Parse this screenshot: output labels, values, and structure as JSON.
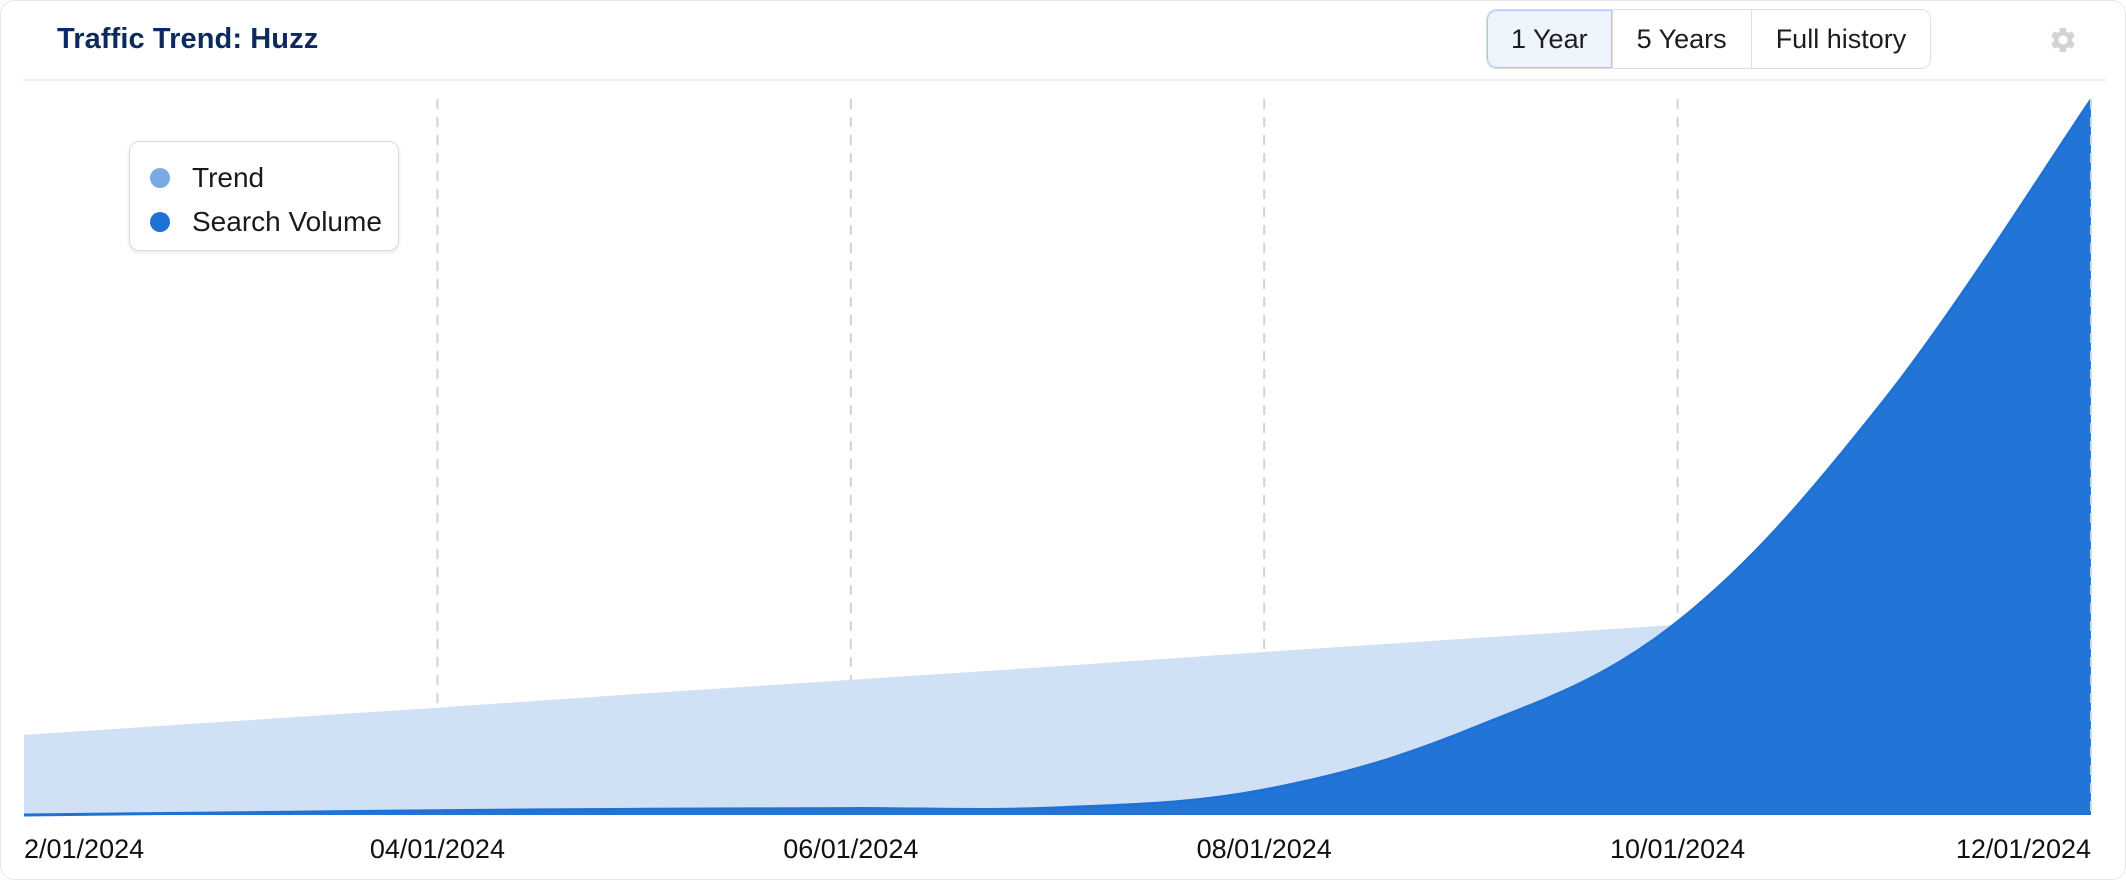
{
  "header": {
    "title": "Traffic Trend: Huzz",
    "range_buttons": [
      {
        "label": "1 Year",
        "active": true
      },
      {
        "label": "5 Years",
        "active": false
      },
      {
        "label": "Full history",
        "active": false
      }
    ],
    "settings_icon": "gear-icon"
  },
  "colors": {
    "title": "#0d2a5c",
    "trend": "#7aa9e6",
    "trend_fill": "#d0e0f5",
    "search_volume": "#1f71d6",
    "gridline": "#cfd3d8",
    "gear": "#d3d3d3"
  },
  "chart_data": {
    "type": "area",
    "title": "Traffic Trend: Huzz",
    "xlabel": "",
    "ylabel": "",
    "x": [
      "02/01/2024",
      "03/01/2024",
      "04/01/2024",
      "05/01/2024",
      "06/01/2024",
      "07/01/2024",
      "08/01/2024",
      "09/01/2024",
      "10/01/2024",
      "11/01/2024",
      "12/01/2024"
    ],
    "tick_labels": [
      "2/01/2024",
      "04/01/2024",
      "06/01/2024",
      "08/01/2024",
      "10/01/2024",
      "12/01/2024"
    ],
    "tick_indices": [
      0,
      2,
      4,
      6,
      8,
      10
    ],
    "series": [
      {
        "name": "Trend",
        "values": [
          11.2,
          13.1,
          15.0,
          17.0,
          18.9,
          20.8,
          22.8,
          24.7,
          26.6,
          28.5,
          30.5
        ]
      },
      {
        "name": "Search Volume",
        "values": [
          0,
          0.3,
          0.6,
          0.8,
          0.9,
          1.0,
          3.5,
          12,
          27,
          58,
          100
        ]
      }
    ],
    "ylim": [
      0,
      100
    ],
    "units": "relative index (no y-axis labels shown)",
    "grid": "vertical dashed at tick dates",
    "legend": {
      "position": "top-left",
      "entries": [
        "Trend",
        "Search Volume"
      ]
    }
  }
}
